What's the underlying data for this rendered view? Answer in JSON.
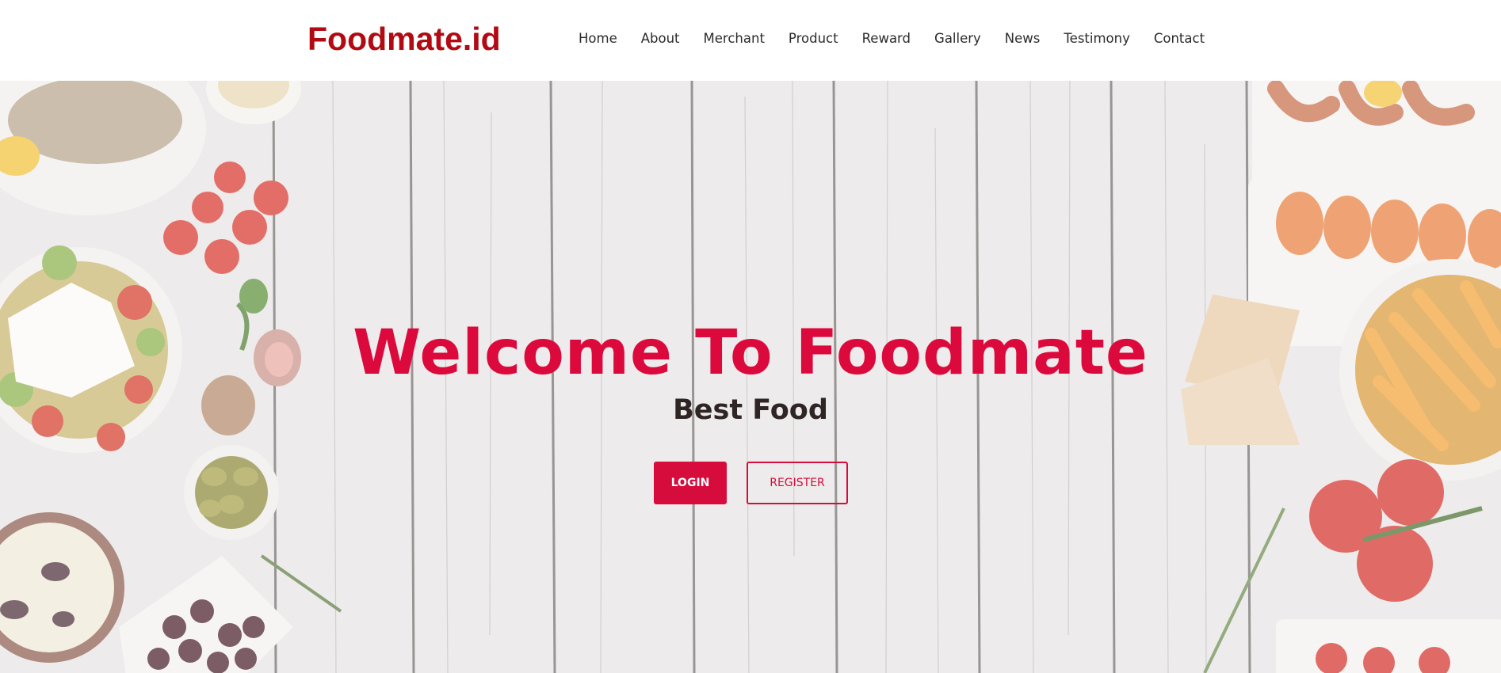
{
  "brand": {
    "name": "Foodmate.id"
  },
  "nav": {
    "items": [
      {
        "label": "Home"
      },
      {
        "label": "About"
      },
      {
        "label": "Merchant"
      },
      {
        "label": "Product"
      },
      {
        "label": "Reward"
      },
      {
        "label": "Gallery"
      },
      {
        "label": "News"
      },
      {
        "label": "Testimony"
      },
      {
        "label": "Contact"
      }
    ]
  },
  "hero": {
    "title": "Welcome To Foodmate",
    "subtitle": "Best Food",
    "login_label": "LOGIN",
    "register_label": "REGISTER"
  },
  "colors": {
    "brand_red": "#b10a12",
    "accent": "#dc0a3c",
    "button": "#d50c3c",
    "wood_background": "#e7e5e4"
  }
}
